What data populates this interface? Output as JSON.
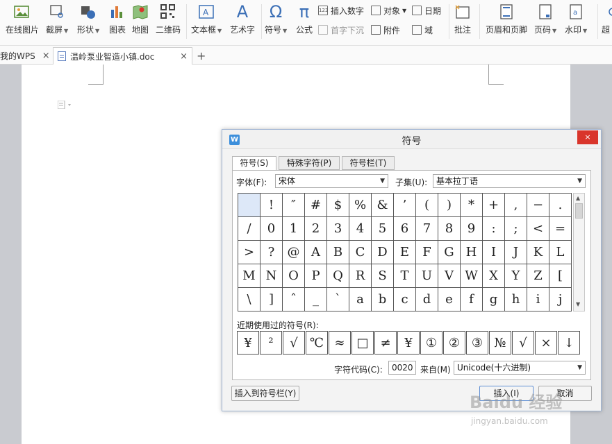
{
  "toolbar": {
    "items": [
      {
        "label": "在线图片",
        "icon": "image-icon",
        "dropdown": false
      },
      {
        "label": "截屏",
        "icon": "screenshot-icon",
        "dropdown": true
      },
      {
        "label": "形状",
        "icon": "shapes-icon",
        "dropdown": true
      },
      {
        "label": "图表",
        "icon": "chart-icon",
        "dropdown": false
      },
      {
        "label": "地图",
        "icon": "map-icon",
        "dropdown": false
      },
      {
        "label": "二维码",
        "icon": "qrcode-icon",
        "dropdown": false
      },
      {
        "label": "文本框",
        "icon": "textbox-icon",
        "dropdown": true
      },
      {
        "label": "艺术字",
        "icon": "wordart-icon",
        "dropdown": false
      },
      {
        "label": "符号",
        "icon": "symbol-icon",
        "dropdown": true
      },
      {
        "label": "公式",
        "icon": "formula-icon",
        "dropdown": false
      },
      {
        "label": "批注",
        "icon": "comment-icon",
        "dropdown": false
      },
      {
        "label": "页眉和页脚",
        "icon": "header-footer-icon",
        "dropdown": false
      },
      {
        "label": "页码",
        "icon": "page-number-icon",
        "dropdown": true
      },
      {
        "label": "水印",
        "icon": "watermark-icon",
        "dropdown": true
      },
      {
        "label": "超",
        "icon": "hyperlink-icon",
        "dropdown": false
      }
    ],
    "small": [
      {
        "label": "插入数字",
        "icon": "insert-number-icon"
      },
      {
        "label": "对象",
        "icon": "object-icon"
      },
      {
        "label": "日期",
        "icon": "date-icon"
      },
      {
        "label": "首字下沉",
        "icon": "drop-cap-icon"
      },
      {
        "label": "附件",
        "icon": "attachment-icon"
      },
      {
        "label": "域",
        "icon": "field-icon"
      }
    ],
    "glyphs": {
      "wordart": "A",
      "symbol": "Ω",
      "formula": "π",
      "insert_number": "123"
    }
  },
  "tabs": {
    "home": "我的WPS",
    "doc": "温岭泵业智造小镇.doc",
    "close": "×",
    "add": "+"
  },
  "dialog": {
    "title": "符号",
    "close": "×",
    "tabs": [
      "符号(S)",
      "特殊字符(P)",
      "符号栏(T)"
    ],
    "font_label": "字体(F):",
    "font_value": "宋体",
    "subset_label": "子集(U):",
    "subset_value": "基本拉丁语",
    "symbols": [
      [
        " ",
        "!",
        "″",
        "#",
        "$",
        "%",
        "&",
        "’",
        "(",
        ")",
        "*",
        "+",
        ",",
        "−",
        "."
      ],
      [
        "/",
        "0",
        "1",
        "2",
        "3",
        "4",
        "5",
        "6",
        "7",
        "8",
        "9",
        ":",
        ";",
        "<",
        "="
      ],
      [
        ">",
        "?",
        "@",
        "A",
        "B",
        "C",
        "D",
        "E",
        "F",
        "G",
        "H",
        "I",
        "J",
        "K",
        "L"
      ],
      [
        "M",
        "N",
        "O",
        "P",
        "Q",
        "R",
        "S",
        "T",
        "U",
        "V",
        "W",
        "X",
        "Y",
        "Z",
        "["
      ],
      [
        "\\",
        "]",
        "ˆ",
        "_",
        "`",
        "a",
        "b",
        "c",
        "d",
        "e",
        "f",
        "g",
        "h",
        "i",
        "j"
      ]
    ],
    "recent_label": "近期使用过的符号(R):",
    "recent": [
      "¥",
      "²",
      "√",
      "℃",
      "≈",
      "□",
      "≠",
      "¥",
      "①",
      "②",
      "③",
      "№",
      "√",
      "×",
      "↓"
    ],
    "char_code_label": "字符代码(C):",
    "char_code_value": "0020",
    "from_label": "来自(M)",
    "from_value": "Unicode(十六进制)",
    "insert_to_bar": "插入到符号栏(Y)",
    "insert": "插入(I)",
    "cancel": "取消"
  },
  "watermark": {
    "logo": "Baidu 经验",
    "url": "jingyan.baidu.com"
  }
}
